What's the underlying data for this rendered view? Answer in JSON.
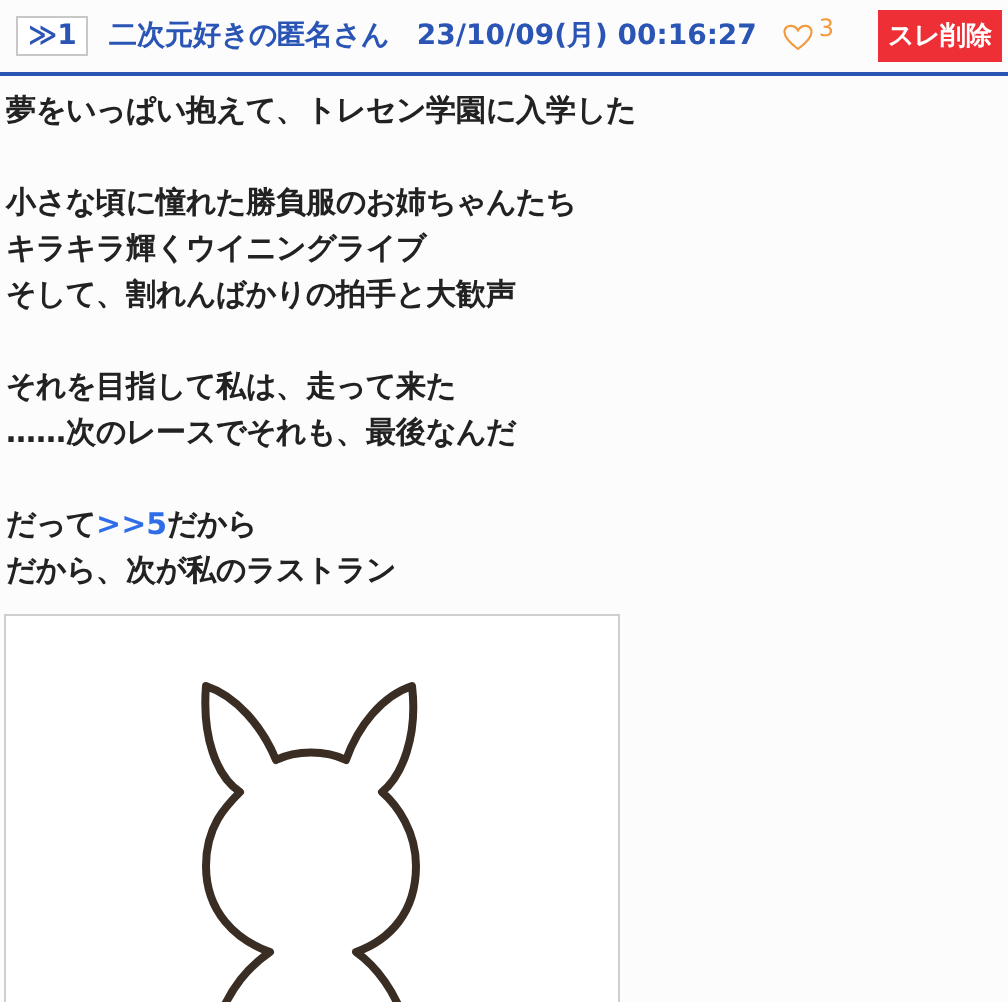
{
  "post": {
    "number": "≫1",
    "author": "二次元好きの匿名さん",
    "timestamp": "23/10/09(月) 00:16:27",
    "likes": "3",
    "liked": false,
    "delete_button": "スレ削除"
  },
  "paragraphs": [
    [
      [
        {
          "kind": "text",
          "text": "夢をいっぱい抱えて、トレセン学園に入学した"
        }
      ]
    ],
    [
      [
        {
          "kind": "text",
          "text": "小さな頃に憧れた勝負服のお姉ちゃんたち"
        }
      ],
      [
        {
          "kind": "text",
          "text": "キラキラ輝くウイニングライブ"
        }
      ],
      [
        {
          "kind": "text",
          "text": "そして、割れんばかりの拍手と大歓声"
        }
      ]
    ],
    [
      [
        {
          "kind": "text",
          "text": "それを目指して私は、走って来た"
        }
      ],
      [
        {
          "kind": "text",
          "text": "……次のレースでそれも、最後なんだ"
        }
      ]
    ],
    [
      [
        {
          "kind": "text",
          "text": "だって"
        },
        {
          "kind": "link",
          "text": ">>5"
        },
        {
          "kind": "text",
          "text": "だから"
        }
      ],
      [
        {
          "kind": "text",
          "text": "だから、次が私のラストラン"
        }
      ]
    ]
  ],
  "attachment": {
    "kind": "picture"
  }
}
